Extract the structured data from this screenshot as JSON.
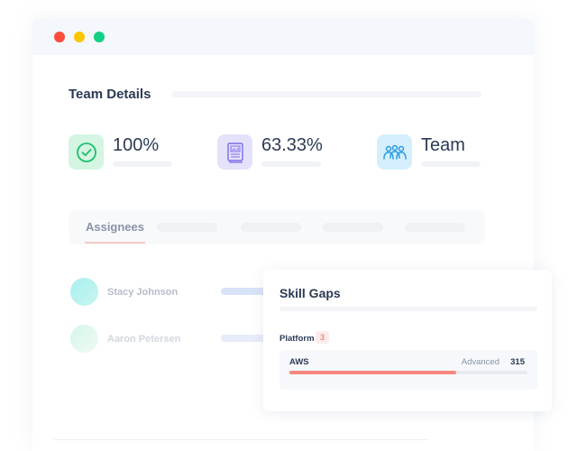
{
  "window": {
    "controls": [
      {
        "name": "close",
        "color": "#fb4c3c"
      },
      {
        "name": "minimize",
        "color": "#fdc500"
      },
      {
        "name": "maximize",
        "color": "#12cf85"
      }
    ]
  },
  "team_details": {
    "title": "Team Details",
    "stats": [
      {
        "icon": "check-circle-icon",
        "value": "100%",
        "icon_bg": "#d3f5e2",
        "icon_color": "#1fbf6e"
      },
      {
        "icon": "report-book-icon",
        "value": "63.33%",
        "icon_bg": "#e4e2fb",
        "icon_color": "#7a6de8"
      },
      {
        "icon": "team-people-icon",
        "value": "Team",
        "icon_bg": "#d5efff",
        "icon_color": "#2a9be0"
      }
    ]
  },
  "tabs": {
    "active": "Assignees"
  },
  "assignees": [
    {
      "name": "Stacy Johnson",
      "avatar_color": "#b8f1ef"
    },
    {
      "name": "Aaron Petersen",
      "avatar_color": "#e2f7ee"
    }
  ],
  "skill_gaps": {
    "title": "Skill Gaps",
    "category": "Platform",
    "category_count": "3",
    "skills": [
      {
        "name": "AWS",
        "level": "Advanced",
        "score": "315",
        "progress": 0.7
      }
    ]
  }
}
